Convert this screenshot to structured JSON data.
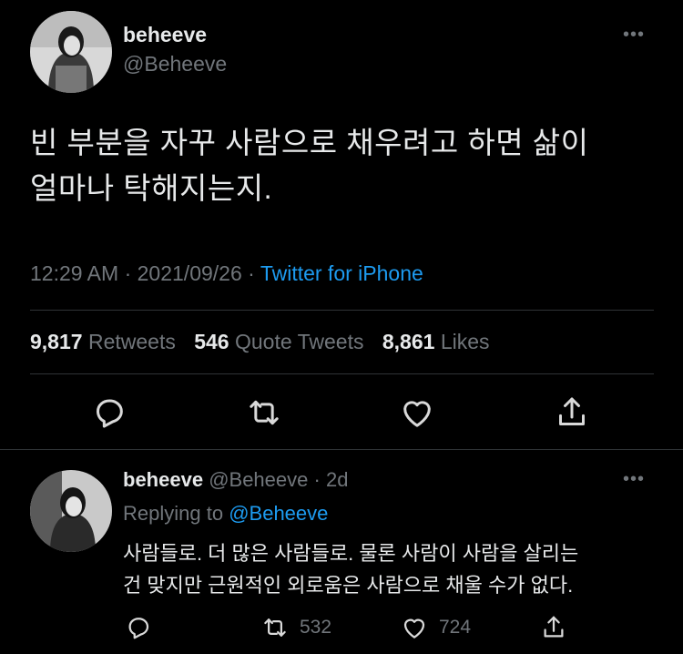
{
  "tweet": {
    "author_name": "beheeve",
    "author_handle": "@Beheeve",
    "more_icon": "more-dots-icon",
    "text_line1": "빈 부분을 자꾸 사람으로 채우려고 하면 삶이",
    "text_line2": "얼마나 탁해지는지.",
    "time": "12:29 AM",
    "sep1": "·",
    "date": "2021/09/26",
    "sep2": "·",
    "source": "Twitter for iPhone",
    "retweets_count": "9,817",
    "retweets_label": "Retweets",
    "quotes_count": "546",
    "quotes_label": "Quote Tweets",
    "likes_count": "8,861",
    "likes_label": "Likes",
    "actions": [
      "reply-icon",
      "retweet-icon",
      "like-icon",
      "share-icon"
    ]
  },
  "reply": {
    "author_name": "beheeve",
    "author_handle": "@Beheeve",
    "sep": "·",
    "age": "2d",
    "replying_to_label": "Replying to",
    "replying_to_handle": "@Beheeve",
    "text_line1": "사람들로. 더 많은 사람들로. 물론 사람이 사람을 살리는",
    "text_line2": "건 맞지만 근원적인 외로움은 사람으로 채울 수가 없다.",
    "retweet_count": "532",
    "like_count": "724"
  },
  "colors": {
    "background": "#000000",
    "text": "#e7e9ea",
    "muted": "#71767b",
    "link": "#1d9bf0",
    "divider": "#2f3336"
  }
}
